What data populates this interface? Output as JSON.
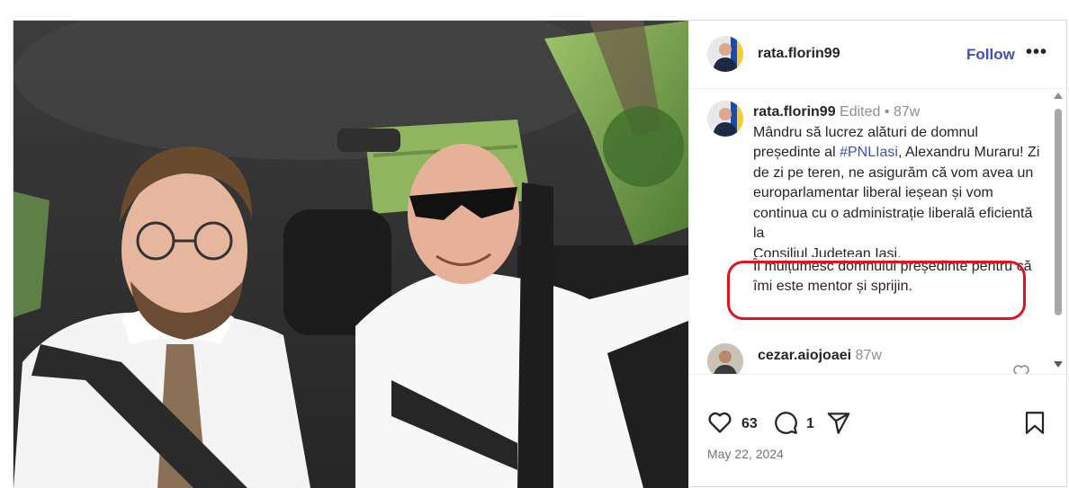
{
  "post": {
    "username": "rata.florin99",
    "follow_label": "Follow",
    "more_label": "•••"
  },
  "caption": {
    "username": "rata.florin99",
    "edited": "Edited",
    "dot": "•",
    "age": "87w",
    "text_1": "Mândru să lucrez alături de domnul președinte al ",
    "hashtag": "#PNLIasi",
    "text_2": ", Alexandru Muraru! Zi de zi pe teren, ne asigurăm că vom avea un europarlamentar liberal ieșean și vom continua cu o administrație liberală eficientă la ",
    "text_clipped": "Consiliul Județean Iași.",
    "text_3": "Îi mulțumesc domnului președinte pentru că îmi este mentor și sprijin."
  },
  "comment": {
    "username": "cezar.aiojoaei",
    "age": "87w"
  },
  "actions": {
    "likes": "63",
    "comments": "1",
    "date": "May 22, 2024"
  },
  "colors": {
    "link": "#3f51b5",
    "highlight": "#e0141e",
    "muted": "#8e8e8e"
  }
}
